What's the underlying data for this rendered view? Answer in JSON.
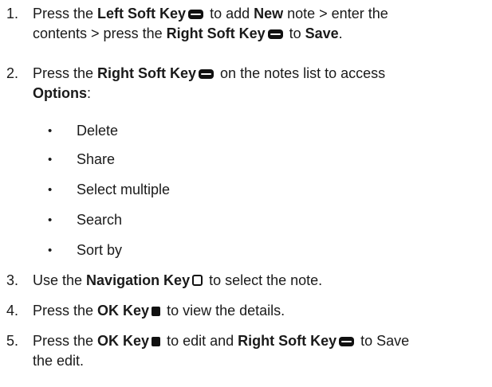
{
  "steps": [
    {
      "number": "1.",
      "line1_a": "Press the ",
      "line1_b": "Left Soft Key",
      "line1_c": " to add ",
      "line1_d": "New",
      "line1_e": " note > enter the",
      "line2_a": "contents > press the ",
      "line2_b": "Right Soft Key",
      "line2_c": " to ",
      "line2_d": "Save",
      "line2_e": ".",
      "icon1": "soft-key-icon",
      "icon2": "soft-key-icon"
    },
    {
      "number": "2.",
      "line1_a": "Press the ",
      "line1_b": "Right Soft Key",
      "line1_c": " on the notes list to access",
      "line2_a": "Options",
      "line2_b": ":",
      "icon1": "soft-key-icon",
      "options": [
        "Delete",
        "Share",
        "Select multiple",
        "Search",
        "Sort by"
      ]
    },
    {
      "number": "3.",
      "line1_a": "Use the ",
      "line1_b": "Navigation Key",
      "line1_c": " to select the note.",
      "icon1": "navigation-key-icon"
    },
    {
      "number": "4.",
      "line1_a": "Press the ",
      "line1_b": "OK Key",
      "line1_c": " to view the details.",
      "icon1": "ok-key-icon"
    },
    {
      "number": "5.",
      "line1_a": "Press the ",
      "line1_b": "OK Key",
      "line1_c": " to edit and ",
      "line1_d": "Right Soft Key",
      "line1_e": " to Save",
      "line2_a": "the edit.",
      "icon1": "ok-key-icon",
      "icon2": "soft-key-icon"
    }
  ],
  "bullet_symbol": "•"
}
